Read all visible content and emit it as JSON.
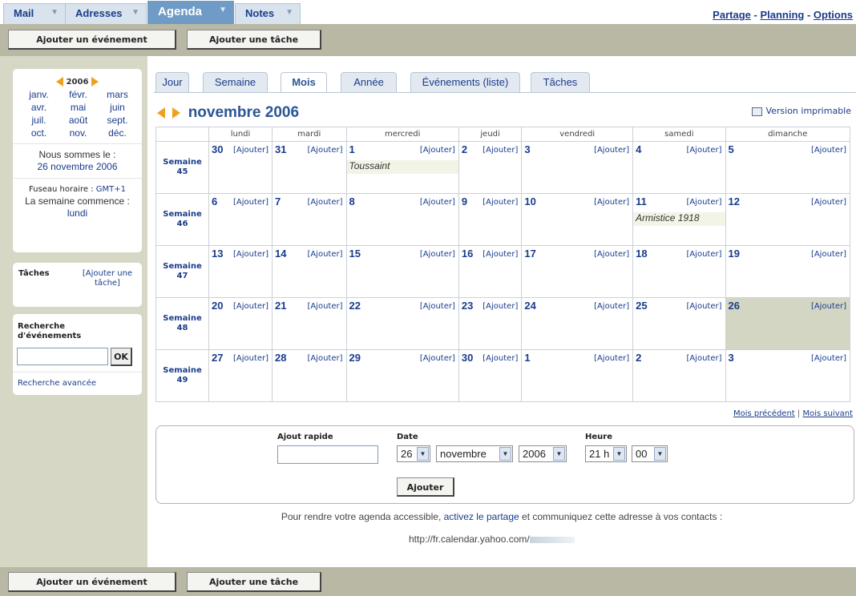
{
  "nav": {
    "tabs": [
      "Mail",
      "Adresses",
      "Agenda",
      "Notes"
    ],
    "links": [
      "Partage",
      "Planning",
      "Options"
    ]
  },
  "toolbar": {
    "add_event": "Ajouter un événement",
    "add_task": "Ajouter une tâche"
  },
  "sidebar": {
    "year": "2006",
    "months": [
      "janv.",
      "févr.",
      "mars",
      "avr.",
      "mai",
      "juin",
      "juil.",
      "août",
      "sept.",
      "oct.",
      "nov.",
      "déc."
    ],
    "today_label": "Nous sommes le :",
    "today_date": "26 novembre 2006",
    "tz_label": "Fuseau horaire :",
    "tz_value": "GMT+1",
    "week_start_label": "La semaine commence :",
    "week_start_value": "lundi",
    "tasks_label": "Tâches",
    "tasks_add": "[Ajouter une tâche]",
    "search_label": "Recherche d'événements",
    "search_button": "OK",
    "search_advanced": "Recherche avancée"
  },
  "views": [
    "Jour",
    "Semaine",
    "Mois",
    "Année",
    "Événements (liste)",
    "Tâches"
  ],
  "month_title": "novembre 2006",
  "print_label": "Version imprimable",
  "weekdays": [
    "lundi",
    "mardi",
    "mercredi",
    "jeudi",
    "vendredi",
    "samedi",
    "dimanche"
  ],
  "add_label": "[Ajouter]",
  "weeks": [
    {
      "label": "Semaine 45",
      "days": [
        "30",
        "31",
        "1",
        "2",
        "3",
        "4",
        "5"
      ]
    },
    {
      "label": "Semaine 46",
      "days": [
        "6",
        "7",
        "8",
        "9",
        "10",
        "11",
        "12"
      ]
    },
    {
      "label": "Semaine 47",
      "days": [
        "13",
        "14",
        "15",
        "16",
        "17",
        "18",
        "19"
      ]
    },
    {
      "label": "Semaine 48",
      "days": [
        "20",
        "21",
        "22",
        "23",
        "24",
        "25",
        "26"
      ]
    },
    {
      "label": "Semaine 49",
      "days": [
        "27",
        "28",
        "29",
        "30",
        "1",
        "2",
        "3"
      ]
    }
  ],
  "events": {
    "toussaint": "Toussaint",
    "armistice": "Armistice 1918"
  },
  "month_nav": {
    "prev": "Mois précédent",
    "sep": "|",
    "next": "Mois suivant"
  },
  "quick_add": {
    "title": "Ajout rapide",
    "date_label": "Date",
    "day": "26",
    "month": "novembre",
    "year": "2006",
    "hour_label": "Heure",
    "hour": "21 h",
    "minute": "00",
    "button": "Ajouter"
  },
  "share": {
    "pre": "Pour rendre votre agenda accessible,",
    "link": "activez le partage",
    "post": "et communiquez cette adresse à vos contacts :",
    "url": "http://fr.calendar.yahoo.com/"
  }
}
